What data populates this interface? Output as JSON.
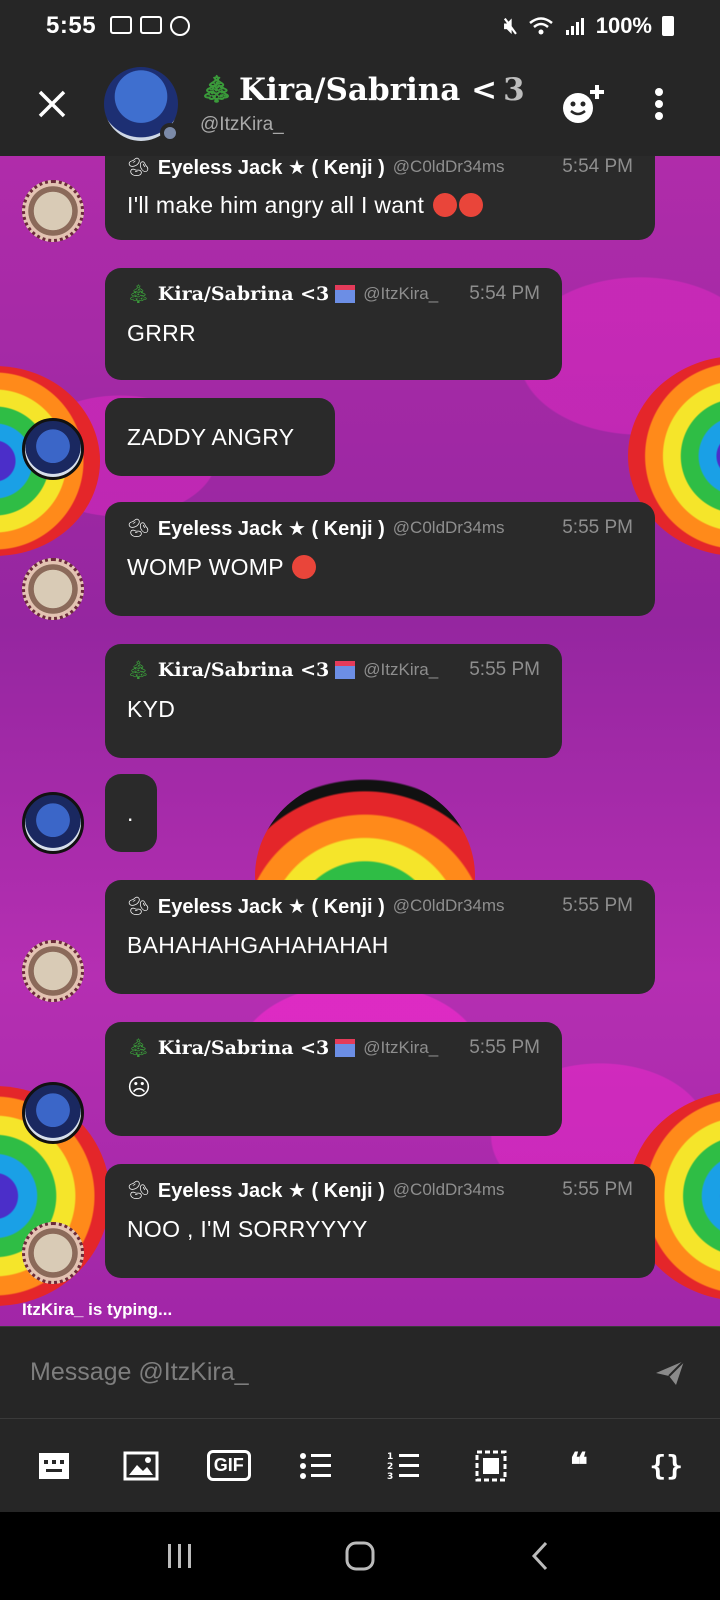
{
  "status_bar": {
    "time": "5:55",
    "battery": "100%"
  },
  "header": {
    "name": "Kira/Sabrina <",
    "name_tail": "3",
    "handle": "@ItzKira_"
  },
  "messages": [
    {
      "id": "m1",
      "user": "Eyeless Jack ★ ( Kenji )",
      "handle": "@C0ldDr34ms",
      "time": "5:54 PM",
      "text": "I'll make him angry all I want",
      "emoji": [
        "angry-face",
        "angry-face"
      ]
    },
    {
      "id": "m2",
      "user": "Kira/Sabrina <3",
      "handle": "@ItzKira_",
      "time": "5:54 PM",
      "text": "GRRR"
    },
    {
      "id": "m3",
      "text": "ZADDY ANGRY"
    },
    {
      "id": "m4",
      "user": "Eyeless Jack ★ ( Kenji )",
      "handle": "@C0ldDr34ms",
      "time": "5:55 PM",
      "text": "WOMP WOMP",
      "emoji": [
        "angry-face"
      ]
    },
    {
      "id": "m5",
      "user": "Kira/Sabrina <3",
      "handle": "@ItzKira_",
      "time": "5:55 PM",
      "text": "KYD"
    },
    {
      "id": "m6",
      "text": "."
    },
    {
      "id": "m7",
      "user": "Eyeless Jack ★ ( Kenji )",
      "handle": "@C0ldDr34ms",
      "time": "5:55 PM",
      "text": "BAHAHAHGAHAHAHAH"
    },
    {
      "id": "m8",
      "user": "Kira/Sabrina <3",
      "handle": "@ItzKira_",
      "time": "5:55 PM",
      "text": "☹"
    },
    {
      "id": "m9",
      "user": "Eyeless Jack ★ ( Kenji )",
      "handle": "@C0ldDr34ms",
      "time": "5:55 PM",
      "text": "NOO , I'M SORRYYYY"
    }
  ],
  "typing_indicator": "ItzKira_ is typing...",
  "composer": {
    "placeholder": "Message @ItzKira_"
  },
  "toolbar": {
    "gif_label": "GIF",
    "quote_label": "❝",
    "code_label": "{}"
  },
  "icons": [
    "close-icon",
    "add-reaction-icon",
    "more-vert-icon",
    "send-icon",
    "keyboard-icon",
    "image-icon",
    "gif-icon",
    "bulleted-list-icon",
    "numbered-list-icon",
    "spoiler-icon",
    "quote-icon",
    "code-block-icon",
    "recents-icon",
    "home-icon",
    "back-icon"
  ]
}
